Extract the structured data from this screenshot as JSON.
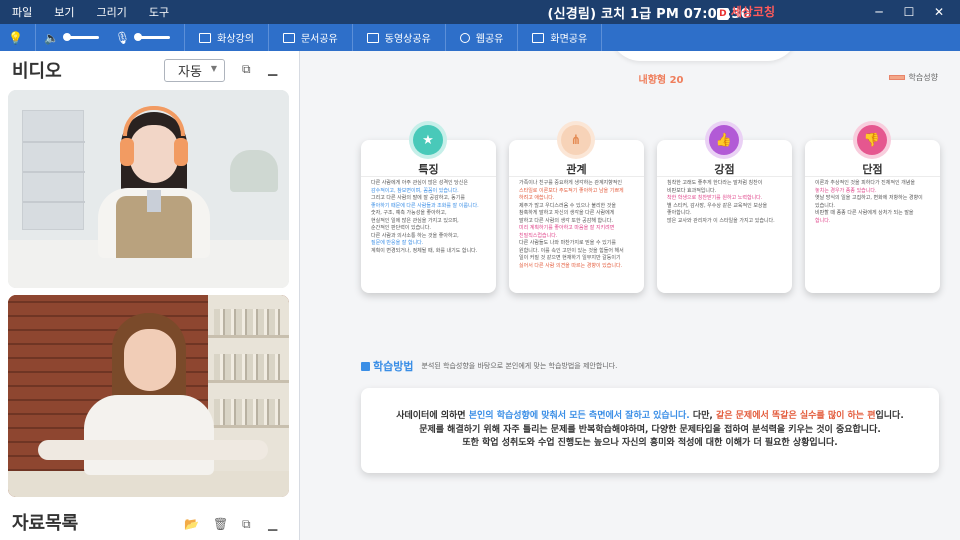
{
  "titlebar": {
    "menu": [
      "파일",
      "보기",
      "그리기",
      "도구"
    ],
    "session": "(신경림) 코치 1급 PM 07:01:30",
    "logo": "세상코칭",
    "logo_mark": "D"
  },
  "toolbar": {
    "buttons": [
      "화상강의",
      "문서공유",
      "동영상공유",
      "웹공유",
      "화면공유"
    ]
  },
  "video_panel": {
    "title": "비디오",
    "select_value": "자동"
  },
  "files_panel": {
    "title": "자료목록"
  },
  "content": {
    "type_title": "내향형 20",
    "legend": "학습성향",
    "cards": [
      {
        "title": "특징",
        "icon": "star-icon",
        "lines": [
          {
            "t": "다른 사람에게 아주 관심이 많은 성격인 당신은",
            "c": ""
          },
          {
            "t": "감수적이고, 참보면이며, 꼼꼼이 있습니다.",
            "c": "hl-blue"
          },
          {
            "t": "그리고 다른 사람의 말에 잘 공감하고, 동기를",
            "c": ""
          },
          {
            "t": "좋아하기 때문에 다른 사람들과 조화를 잘 이룹니다.",
            "c": "hl-blue"
          },
          {
            "t": "숫자, 구조, 예측 가능성을 좋아하고,",
            "c": ""
          },
          {
            "t": "현실적인 일에 많은 관심을 가지고 있으며,",
            "c": ""
          },
          {
            "t": "순간적인 판단력이 있습니다.",
            "c": ""
          },
          {
            "t": "다른 사람과 의사소통 하는 것을 좋아하고,",
            "c": ""
          },
          {
            "t": "질문에 반응을 잘 합니다.",
            "c": "hl-blue"
          },
          {
            "t": "계획이 변경되거나, 정체될 때, 화를 내기도 합니다.",
            "c": ""
          }
        ]
      },
      {
        "title": "관계",
        "icon": "network-icon",
        "lines": [
          {
            "t": "가족이나 친구를 중요하게 생각하는 관계지향적인",
            "c": ""
          },
          {
            "t": "스타일로 이론보다 주도적기 좋아하고 남을 기쁘게",
            "c": "hl-red"
          },
          {
            "t": "하려고 애씁니다.",
            "c": "hl-red"
          },
          {
            "t": "제주가 많고 우디스러움 수 있으나 불리한 것을",
            "c": ""
          },
          {
            "t": "참혹하게 말하고 자신의 생각을 다른 사람에게",
            "c": ""
          },
          {
            "t": "말하고 다른 사람의 생각 또한 공감해 합니다.",
            "c": ""
          },
          {
            "t": "미리 계획하기를 좋아하고 마음을 잘 지키려면",
            "c": "hl-pink"
          },
          {
            "t": "친밀직스럽습니다.",
            "c": "hl-pink"
          },
          {
            "t": "다른 사람들도 나와 마찬가지로 믿을 수 있기를",
            "c": ""
          },
          {
            "t": "원합니다. 이를 속인 고민이 있는 것을 힘들어 해서",
            "c": ""
          },
          {
            "t": "일이 커질 것 같으면 현재하기 일부지만 갈등이기",
            "c": ""
          },
          {
            "t": "싫어서 다른 사람 의견을 따르는 경향이 있습니다.",
            "c": "hl-red"
          }
        ]
      },
      {
        "title": "강점",
        "icon": "thumbs-up-icon",
        "lines": [
          {
            "t": "침착한 고래도 좋추게 한다라는 말처럼 칭찬이",
            "c": ""
          },
          {
            "t": "비판보다 효과적입니다.",
            "c": ""
          },
          {
            "t": "착한 학생으로 칭찬받기를 원하고 노력합니다.",
            "c": "hl-pink"
          },
          {
            "t": "별 스티커, 감사장, 우수상 같은 교육적인 보상을",
            "c": ""
          },
          {
            "t": "좋아합니다.",
            "c": ""
          },
          {
            "t": "많은 교사와 관리자가 이 스타일을 가지고 있습니다.",
            "c": ""
          }
        ]
      },
      {
        "title": "단점",
        "icon": "thumbs-down-icon",
        "lines": [
          {
            "t": "이론과 추상적인 것을 피하다가 진체적인 개념을",
            "c": ""
          },
          {
            "t": "놓치는 경우가 종종 있습니다.",
            "c": "hl-pink"
          },
          {
            "t": "옛날 방식의 일을 고집하고, 변화에 저항하는 경향이",
            "c": ""
          },
          {
            "t": "있습니다.",
            "c": ""
          },
          {
            "t": "비판할 때 종종 다른 사람에게 상처가 되는 말을",
            "c": ""
          },
          {
            "t": "합니다.",
            "c": "hl-pink"
          }
        ]
      }
    ],
    "method": {
      "title": "학습방법",
      "desc": "분석된 학습성향을 바탕으로 본인에게 맞는 학습방법을 제안합니다."
    },
    "summary": [
      [
        {
          "t": "사데이터에 의하면 ",
          "c": ""
        },
        {
          "t": "본인의 학습성향에 맞춰서 모든 측면에서 잘하고 있습니다.",
          "c": "hl-blue"
        },
        {
          "t": " 다만, ",
          "c": ""
        },
        {
          "t": "같은 문제에서 똑같은 실수를 많이 하는 편",
          "c": "hl-red"
        },
        {
          "t": "입니다.",
          "c": ""
        }
      ],
      [
        {
          "t": "문제를 해결하기 위해 자주 틀리는 문제를 반복학습해야하며, 다양한 문제타입을 접하여 분석력을 키우는 것이 중요합니다.",
          "c": ""
        }
      ],
      [
        {
          "t": "또한 학업 성취도와 수업 진행도는 높으나 자신의 흥미와 적성에 대한 이해가 더 필요한 상황입니다.",
          "c": ""
        }
      ]
    ]
  }
}
